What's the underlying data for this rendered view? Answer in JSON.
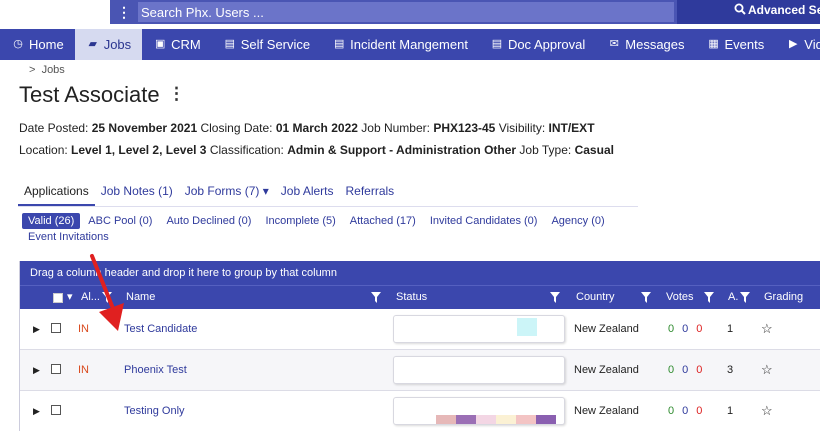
{
  "search": {
    "placeholder": "Search Phx. Users ...",
    "menu_glyph": "⋮",
    "advanced": "Advanced Search"
  },
  "nav": [
    {
      "label": "Home",
      "icon": "clock-icon",
      "glyph": "◷"
    },
    {
      "label": "Jobs",
      "icon": "folder-open-icon",
      "glyph": "▰",
      "active": true
    },
    {
      "label": "CRM",
      "icon": "briefcase-icon",
      "glyph": "▣"
    },
    {
      "label": "Self Service",
      "icon": "list-icon",
      "glyph": "▤"
    },
    {
      "label": "Incident Mangement",
      "icon": "list-icon",
      "glyph": "▤"
    },
    {
      "label": "Doc Approval",
      "icon": "document-icon",
      "glyph": "▤"
    },
    {
      "label": "Messages",
      "icon": "envelope-icon",
      "glyph": "✉"
    },
    {
      "label": "Events",
      "icon": "calendar-icon",
      "glyph": "▦"
    },
    {
      "label": "Video",
      "icon": "video-icon",
      "glyph": "▶"
    }
  ],
  "breadcrumb": {
    "sep": ">",
    "label": "Jobs"
  },
  "page": {
    "title": "Test Associate",
    "menu_glyph": "⋮"
  },
  "meta1": {
    "date_posted_label": "Date Posted:",
    "date_posted": "25 November 2021",
    "closing_label": "Closing Date:",
    "closing": "01 March 2022",
    "job_number_label": "Job Number:",
    "job_number": "PHX123-45",
    "visibility_label": "Visibility:",
    "visibility": "INT/EXT"
  },
  "meta2": {
    "location_label": "Location:",
    "location": "Level 1, Level 2, Level 3",
    "classification_label": "Classification:",
    "classification": "Admin & Support - Administration Other",
    "job_type_label": "Job Type:",
    "job_type": "Casual"
  },
  "tabs": [
    "Applications",
    "Job Notes (1)",
    "Job Forms (7) ▾",
    "Job Alerts",
    "Referrals"
  ],
  "subtabs": [
    "Valid (26)",
    "ABC Pool (0)",
    "Auto Declined (0)",
    "Incomplete (5)",
    "Attached (17)",
    "Invited Candidates (0)",
    "Agency (0)",
    "Event Invitations"
  ],
  "grid": {
    "group_hint": "Drag a column header and drop it here to group by that column",
    "headers": {
      "alert": "Al...",
      "name": "Name",
      "status": "Status",
      "country": "Country",
      "votes": "Votes",
      "a": "A.",
      "grading": "Grading"
    },
    "rows": [
      {
        "alert": "IN",
        "name": "Test Candidate",
        "country": "New Zealand",
        "votes": [
          "0",
          "0",
          "0"
        ],
        "a": "1",
        "star": "☆",
        "swatches": [
          "#ccf5f8"
        ]
      },
      {
        "alert": "IN",
        "name": "Phoenix Test",
        "country": "New Zealand",
        "votes": [
          "0",
          "0",
          "0"
        ],
        "a": "3",
        "star": "☆",
        "swatches": []
      },
      {
        "alert": "",
        "name": "Testing Only",
        "country": "New Zealand",
        "votes": [
          "0",
          "0",
          "0"
        ],
        "a": "1",
        "star": "☆",
        "swatches": [
          "#e6b8b8",
          "#9b6fb5",
          "#f3d6e4",
          "#fbf1d4",
          "#f3c4c4",
          "#8a5fb0"
        ]
      }
    ]
  },
  "colors": {
    "nav": "#3b47ad",
    "accent": "#2f3a9c",
    "alert": "#d94a1e",
    "arrow": "#e02020"
  }
}
